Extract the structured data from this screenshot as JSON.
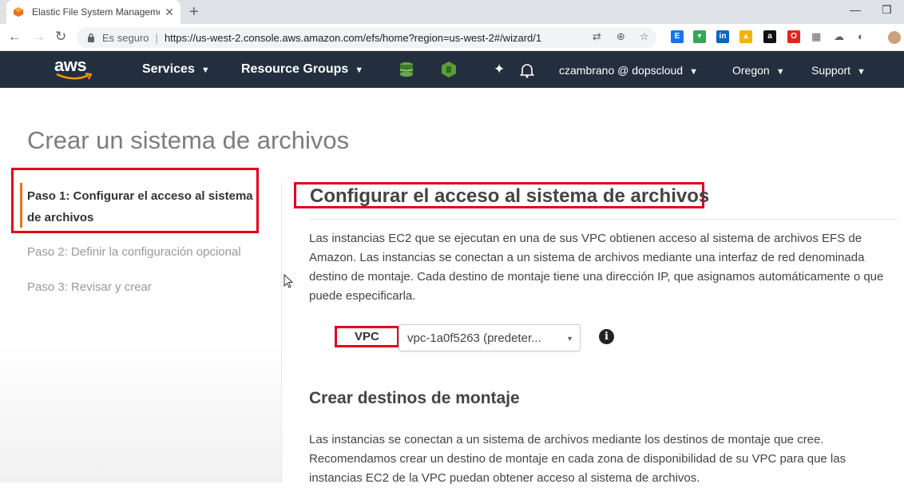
{
  "browser": {
    "tab_title": "Elastic File System Management C",
    "tab_close": "✕",
    "new_tab": "+",
    "minimize": "—",
    "restore": "❐",
    "secure_label": "Es seguro",
    "url": "https://us-west-2.console.aws.amazon.com/efs/home?region=us-west-2#/wizard/1",
    "extensions": [
      {
        "icon": "e-extension-icon",
        "color": "#1a73e8",
        "text": "E"
      },
      {
        "icon": "inbox-extension-icon",
        "color": "#34a853",
        "text": "▾"
      },
      {
        "icon": "linkedin-icon",
        "color": "#0a66c2",
        "text": "in"
      },
      {
        "icon": "drive-icon",
        "color": "#f4b400",
        "text": "▲"
      },
      {
        "icon": "amazon-assistant-icon",
        "color": "#111111",
        "text": "a"
      },
      {
        "icon": "opera-icon",
        "color": "#e1251b",
        "text": "O"
      }
    ]
  },
  "aws_nav": {
    "logo": "aws",
    "services": "Services",
    "resource_groups": "Resource Groups",
    "account": "czambrano @ dopscloud",
    "region": "Oregon",
    "support": "Support",
    "caret": "▼"
  },
  "page": {
    "title": "Crear un sistema de archivos",
    "steps": [
      {
        "label": "Paso 1: Configurar el acceso al sistema de archivos",
        "active": true
      },
      {
        "label": "Paso 2: Definir la configuración opcional",
        "active": false
      },
      {
        "label": "Paso 3: Revisar y crear",
        "active": false
      }
    ],
    "section_title": "Configurar el acceso al sistema de archivos",
    "intro": "Las instancias EC2 que se ejecutan en una de sus VPC obtienen acceso al sistema de archivos EFS de Amazon. Las instancias se conectan a un sistema de archivos mediante una interfaz de red denominada destino de montaje. Cada destino de montaje tiene una dirección IP, que asignamos automáticamente o que puede especificarla.",
    "vpc_label": "VPC",
    "vpc_value": "vpc-1a0f5263 (predeter...",
    "info_glyph": "i",
    "mount_title": "Crear destinos de montaje",
    "mount_text": "Las instancias se conectan a un sistema de archivos mediante los destinos de montaje que cree. Recomendamos crear un destino de montaje en cada zona de disponibilidad de su VPC para que las instancias EC2 de la VPC puedan obtener acceso al sistema de archivos."
  },
  "colors": {
    "aws_nav_bg": "#232f3e",
    "aws_orange": "#ff9900",
    "highlight_red": "#e3001b",
    "step_bar": "#ec7211"
  }
}
